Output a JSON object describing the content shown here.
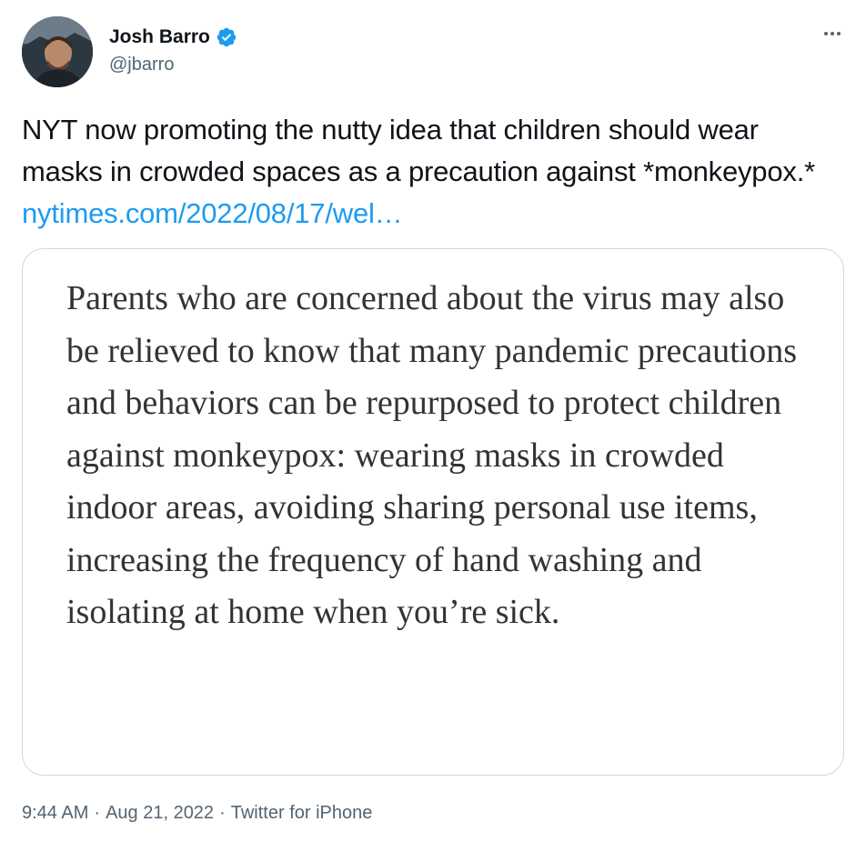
{
  "author": {
    "name": "Josh Barro",
    "handle": "@jbarro",
    "verified_icon": "verified-badge-icon"
  },
  "tweet": {
    "text": "NYT now promoting the nutty idea that children should wear masks in crowded spaces as a precaution against *monkeypox.*",
    "link": "nytimes.com/2022/08/17/wel…"
  },
  "quote": {
    "text": "Parents who are concerned about the virus may also be relieved to know that many pandemic precautions and behaviors can be repurposed to protect children against monkeypox: wearing masks in crowded indoor areas, avoiding sharing personal use items, increasing the frequency of hand washing and isolating at home when you’re sick."
  },
  "meta": {
    "time": "9:44 AM",
    "separator": "·",
    "date": "Aug 21, 2022",
    "source": "Twitter for iPhone"
  },
  "colors": {
    "link": "#1d9bf0",
    "verified": "#1d9bf0",
    "secondary_text": "#536471",
    "card_border": "#cfd9de"
  }
}
